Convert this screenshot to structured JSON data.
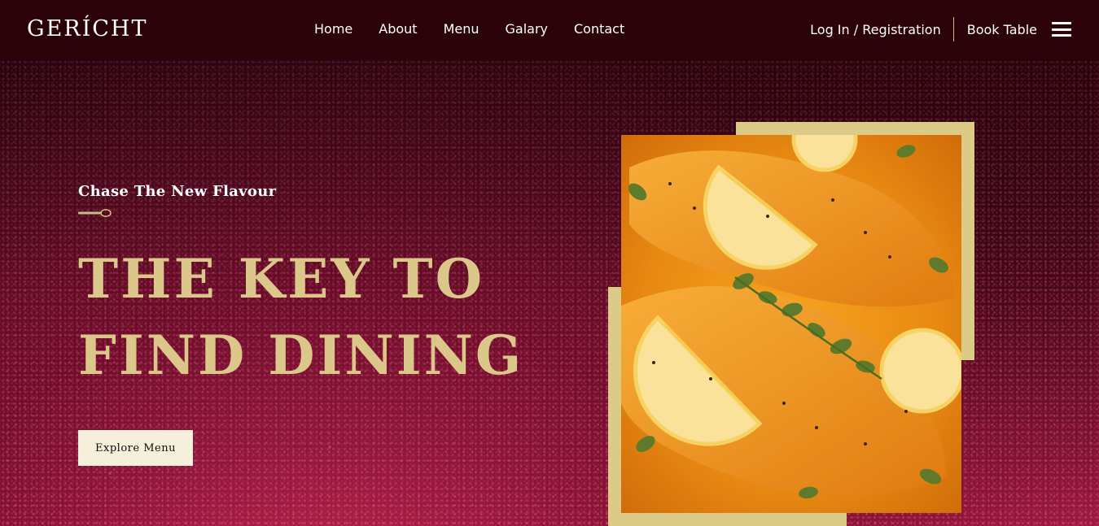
{
  "brand": {
    "logo_text": "GERÍCHT"
  },
  "nav": {
    "links": [
      "Home",
      "About",
      "Menu",
      "Galary",
      "Contact"
    ],
    "login_label": "Log In / Registration",
    "book_label": "Book Table"
  },
  "hero": {
    "subtitle": "Chase The New Flavour",
    "headline_line1": "THE KEY TO",
    "headline_line2": "FIND DINING",
    "cta_label": "Explore Menu"
  },
  "colors": {
    "nav_background": "#2b0207",
    "accent_gold": "#dcca87",
    "button_background": "#f5efdb"
  },
  "icons": {
    "menu": "hamburger-menu-icon",
    "divider": "spoon-icon"
  }
}
